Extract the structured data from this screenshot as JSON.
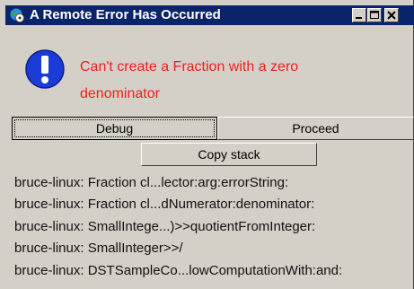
{
  "window": {
    "title": "A Remote Error Has Occurred",
    "titlebar_color": "#0a246a",
    "icons": [
      "app-icon",
      "minimize-icon",
      "maximize-icon",
      "close-icon"
    ]
  },
  "dialog": {
    "icon": "exclamation-icon",
    "message": "Can't create a Fraction with a zero denominator",
    "message_color": "#ee1e1e"
  },
  "buttons": {
    "debug_label": "Debug",
    "proceed_label": "Proceed",
    "copy_stack_label": "Copy stack"
  },
  "stack": [
    "bruce-linux: Fraction cl...lector:arg:errorString:",
    "bruce-linux: Fraction cl...dNumerator:denominator:",
    "bruce-linux: SmallIntege...)>>quotientFromInteger:",
    "bruce-linux: SmallInteger>>/",
    "bruce-linux: DSTSampleCo...lowComputationWith:and:"
  ]
}
